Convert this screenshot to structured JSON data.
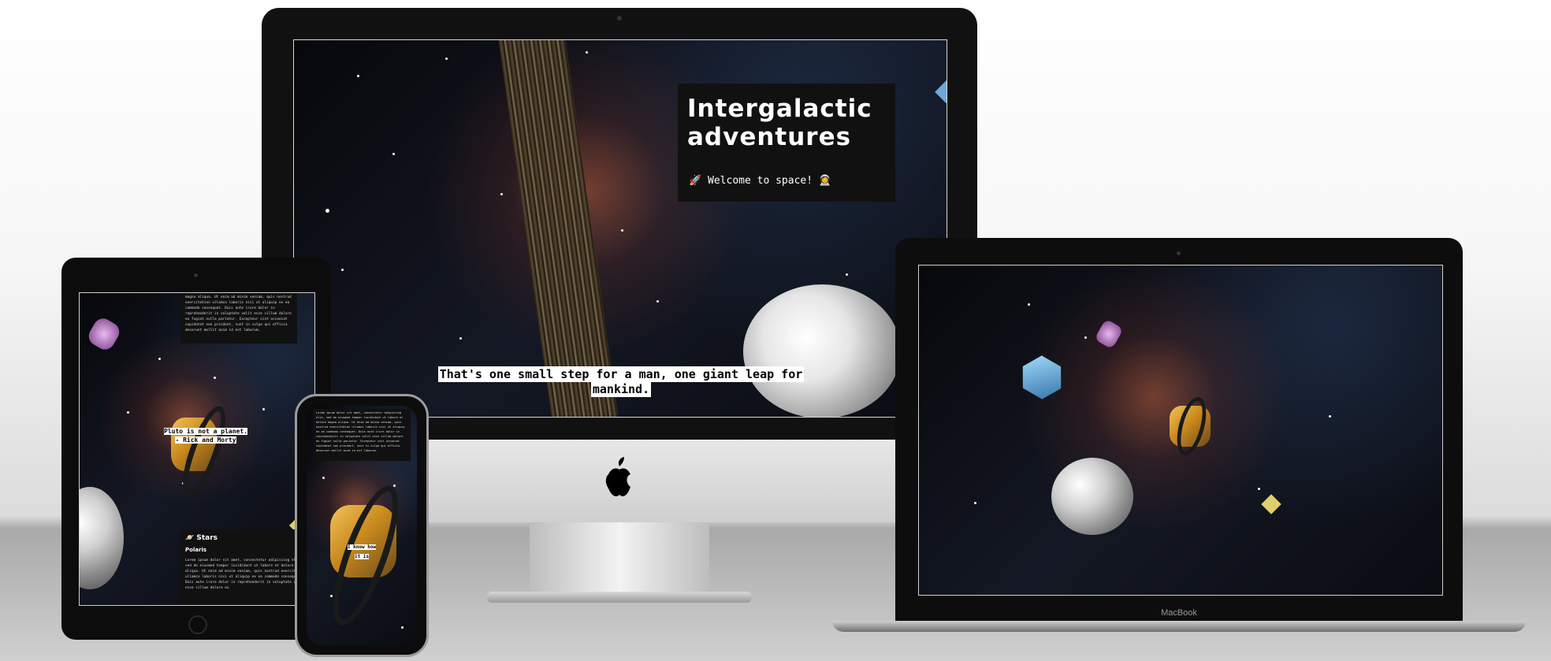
{
  "imac": {
    "title_line1": "Intergalactic",
    "title_line2": "adventures",
    "subtitle": "🚀 Welcome to space! 👩‍🚀",
    "quote_line1": "That's one small step for a man, one giant leap for",
    "quote_line2": "mankind."
  },
  "ipad": {
    "quote_line1": "Pluto is not a planet.",
    "quote_line2": "- Rick and Morty",
    "section_heading": "🪐 Stars",
    "section_subheading": "Polaris",
    "top_para": "magna aliqua. Ut enim ad minim veniam, quis nostrud exercitation ullamco laboris nisi ut aliquip ex ea commodo consequat. Duis aute irure dolor in reprehenderit in voluptate velit esse cillum dolore eu fugiat nulla pariatur. Excepteur sint occaecat cupidatat non proident, sunt in culpa qui officia deserunt mollit anim id est laborum.",
    "body_para": "Lorem ipsum dolor sit amet, consectetur adipiscing elit, sed do eiusmod tempor incididunt ut labore et dolore magna aliqua. Ut enim ad minim veniam, quis nostrud exercitation ullamco laboris nisi ut aliquip ex ea commodo consequat. Duis aute irure dolor in reprehenderit in voluptate velit esse cillum dolore eu"
  },
  "iphone": {
    "top_para": "Lorem ipsum dolor sit amet, consectetur adipiscing elit, sed do eiusmod tempor incididunt ut labore et dolore magna aliqua. Ut enim ad minim veniam, quis nostrud exercitation ullamco laboris nisi ut aliquip ex ea commodo consequat. Duis aute irure dolor in reprehenderit in voluptate velit esse cillum dolore eu fugiat nulla pariatur. Excepteur sint occaecat cupidatat non proident, sunt in culpa qui officia deserunt mollit anim id est laborum.",
    "quote_line1": "I know how",
    "quote_line2": "it is"
  },
  "macbook": {
    "brand_label": "MacBook"
  },
  "colors": {
    "accent_white": "#ffffff",
    "panel_dark": "#111111",
    "space_bg": "#0b0d13",
    "nebula": "#c4603e"
  },
  "icons": [
    "apple-logo-icon",
    "rocket-icon",
    "astronaut-icon",
    "planet-icon"
  ]
}
